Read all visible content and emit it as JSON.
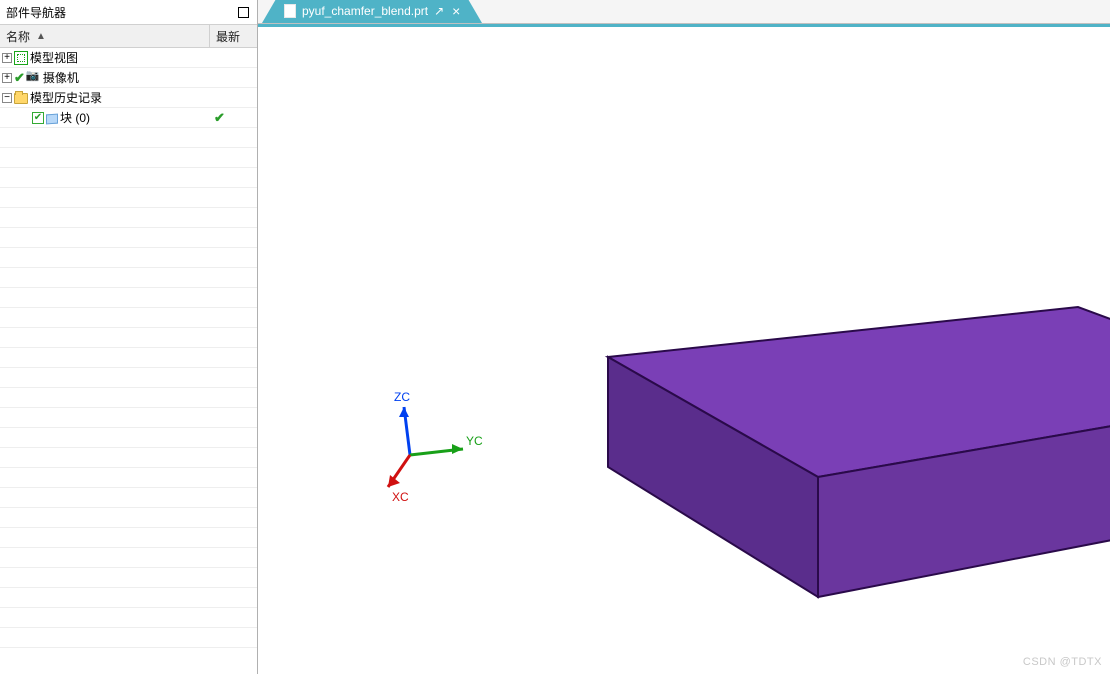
{
  "sidebar": {
    "title": "部件导航器",
    "columns": {
      "name": "名称",
      "latest": "最新",
      "sort_indicator": "▲"
    },
    "items": [
      {
        "label": "模型视图",
        "icon": "views-icon",
        "expandable": true,
        "expanded": false,
        "indent": 0,
        "checked": null,
        "latest": false
      },
      {
        "label": "摄像机",
        "icon": "camera-icon",
        "expandable": true,
        "expanded": false,
        "indent": 0,
        "checked": "tick",
        "latest": false
      },
      {
        "label": "模型历史记录",
        "icon": "folder-icon",
        "expandable": true,
        "expanded": true,
        "indent": 0,
        "checked": null,
        "latest": false
      },
      {
        "label": "块 (0)",
        "icon": "cube-icon",
        "expandable": false,
        "expanded": false,
        "indent": 1,
        "checked": "box",
        "latest": true
      }
    ]
  },
  "tab": {
    "filename": "pyuf_chamfer_blend.prt",
    "sub_icon": "↗",
    "close": "×"
  },
  "triad": {
    "z": {
      "label": "ZC",
      "color": "#0040f0"
    },
    "y": {
      "label": "YC",
      "color": "#18a018"
    },
    "x": {
      "label": "XC",
      "color": "#d01010"
    }
  },
  "colors": {
    "block_top": "#7a3fb6",
    "block_front": "#5a2d8c",
    "block_side": "#6a369e",
    "block_edge": "#2a0a4a"
  },
  "watermark": "CSDN @TDTX"
}
